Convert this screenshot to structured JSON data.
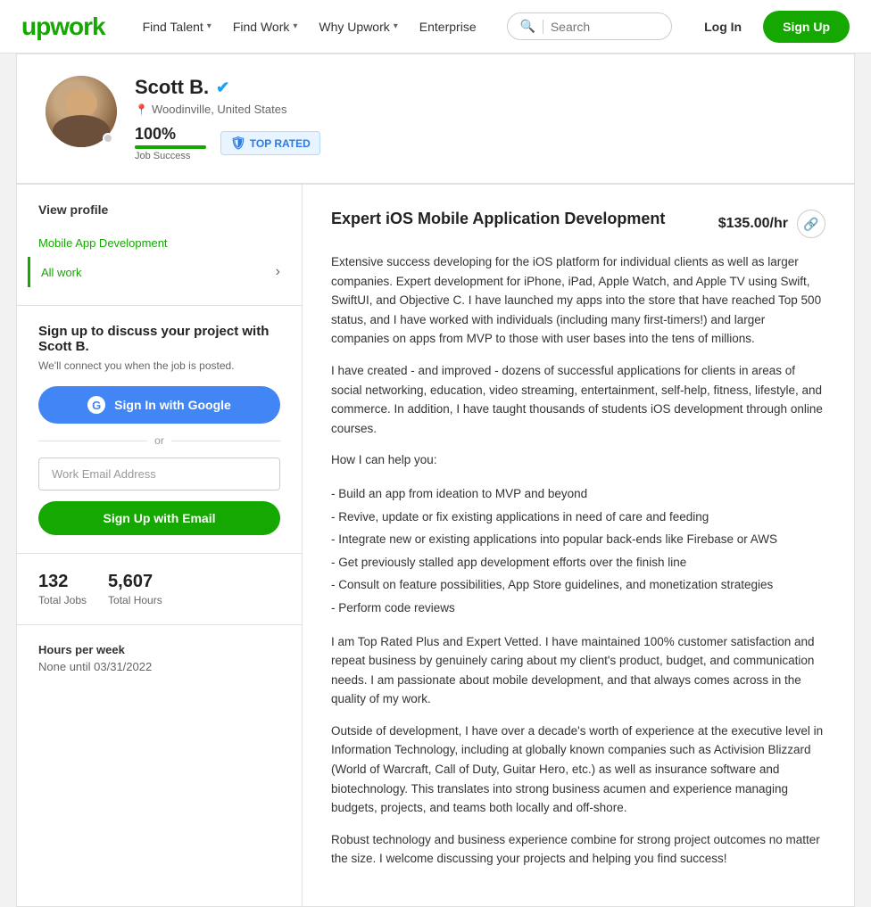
{
  "nav": {
    "logo": "upwork",
    "links": [
      {
        "label": "Find Talent",
        "has_chevron": true
      },
      {
        "label": "Find Work",
        "has_chevron": true
      },
      {
        "label": "Why Upwork",
        "has_chevron": true
      },
      {
        "label": "Enterprise",
        "has_chevron": false
      }
    ],
    "search_placeholder": "Search",
    "login_label": "Log In",
    "signup_label": "Sign Up"
  },
  "profile": {
    "name": "Scott B.",
    "verified": true,
    "location": "Woodinville, United States",
    "job_success_pct": "100%",
    "job_success_label": "Job Success",
    "top_rated_label": "TOP RATED",
    "online": true
  },
  "sidebar": {
    "view_profile_label": "View profile",
    "links": [
      {
        "label": "Mobile App Development",
        "active": false
      },
      {
        "label": "All work",
        "active": true,
        "has_arrow": true
      }
    ],
    "signup_title": "Sign up to discuss your project with Scott B.",
    "signup_subtitle": "We'll connect you when the job is posted.",
    "google_btn_label": "Sign In with Google",
    "or_label": "or",
    "email_placeholder": "Work Email Address",
    "email_btn_label": "Sign Up with Email",
    "stats": [
      {
        "value": "132",
        "label": "Total Jobs"
      },
      {
        "value": "5,607",
        "label": "Total Hours"
      }
    ],
    "hours_title": "Hours per week",
    "hours_value": "None until 03/31/2022"
  },
  "job": {
    "title": "Expert iOS Mobile Application Development",
    "rate": "$135.00/hr",
    "description_paragraphs": [
      "Extensive success developing for the iOS platform for individual clients as well as larger companies. Expert development for iPhone, iPad, Apple Watch, and Apple TV using Swift, SwiftUI, and Objective C. I have launched my apps into the store that have reached Top 500 status, and I have worked with individuals (including many first-timers!) and larger companies on apps from MVP to those with user bases into the tens of millions.",
      "I have created - and improved - dozens of successful applications for clients in areas of social networking, education, video streaming, entertainment, self-help, fitness, lifestyle, and commerce. In addition, I have taught thousands of students iOS development through online courses.",
      "How I can help you:"
    ],
    "bullets": [
      "- Build an app from ideation to MVP and beyond",
      "- Revive, update or fix existing applications in need of care and feeding",
      "- Integrate new or existing applications into popular back-ends like Firebase or AWS",
      "- Get previously stalled app development efforts over the finish line",
      "- Consult on feature possibilities, App Store guidelines, and monetization strategies",
      "- Perform code reviews"
    ],
    "description_paragraphs2": [
      "I am Top Rated Plus and Expert Vetted. I have maintained 100% customer satisfaction and repeat business by genuinely caring about my client's product, budget, and communication needs. I am passionate about mobile development, and that always comes across in the quality of my work.",
      "Outside of development, I have over a decade's worth of experience at the executive level in Information Technology, including at globally known companies such as Activision Blizzard (World of Warcraft, Call of Duty, Guitar Hero, etc.) as well as insurance software and biotechnology. This translates into strong business acumen and experience managing budgets, projects, and teams both locally and off-shore.",
      "Robust technology and business experience combine for strong project outcomes no matter the size. I welcome discussing your projects and helping you find success!"
    ]
  }
}
